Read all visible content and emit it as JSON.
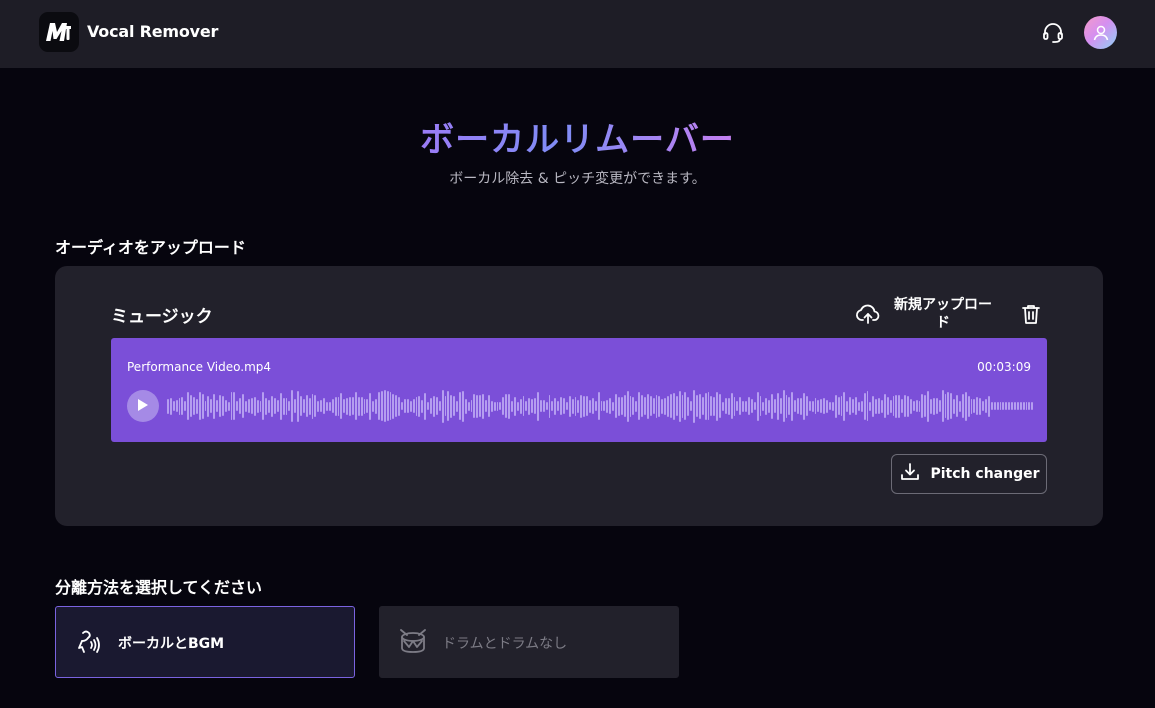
{
  "header": {
    "app_title": "Vocal Remover",
    "logo_icon": "logo-m-icon",
    "support_icon": "headset-icon",
    "avatar_icon": "user-avatar-icon"
  },
  "hero": {
    "title": "ボーカルリムーバー",
    "subtitle": "ボーカル除去 & ピッチ変更ができます。"
  },
  "upload_section": {
    "heading": "オーディオをアップロード",
    "music_label": "ミュージック",
    "new_upload_label": "新規アップロード",
    "delete_icon": "trash-icon",
    "player": {
      "file_name": "Performance Video.mp4",
      "duration": "00:03:09",
      "play_icon": "play-icon"
    },
    "pitch_changer_label": "Pitch changer"
  },
  "separation": {
    "heading": "分離方法を選択してください",
    "options": [
      {
        "label": "ボーカルとBGM",
        "icon": "vocal-wave-icon",
        "selected": true
      },
      {
        "label": "ドラムとドラムなし",
        "icon": "drum-icon",
        "selected": false
      }
    ]
  },
  "colors": {
    "accent_purple": "#7b4fd8",
    "selected_border": "#7a63e0",
    "background": "#06050e",
    "card": "#22212b"
  }
}
